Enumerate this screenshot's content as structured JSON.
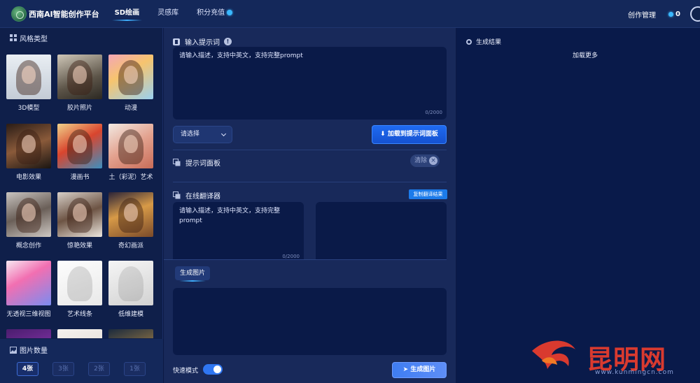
{
  "header": {
    "app_title": "西南AI智能创作平台",
    "nav": [
      {
        "label": "SD绘画",
        "active": true
      },
      {
        "label": "灵感库",
        "active": false
      },
      {
        "label": "积分充值",
        "active": false
      }
    ],
    "create_management": "创作管理",
    "points_value": "0"
  },
  "sidebar": {
    "style_title": "风格类型",
    "styles": [
      {
        "label": "3D模型"
      },
      {
        "label": "胶片照片"
      },
      {
        "label": "动漫"
      },
      {
        "label": "电影效果"
      },
      {
        "label": "漫画书"
      },
      {
        "label": "土（彩泥）艺术"
      },
      {
        "label": "概念创作"
      },
      {
        "label": "惊艳效果"
      },
      {
        "label": "奇幻画派"
      },
      {
        "label": "无透视三维视图"
      },
      {
        "label": "艺术线条"
      },
      {
        "label": "低维建模"
      },
      {
        "label": ""
      },
      {
        "label": ""
      },
      {
        "label": ""
      }
    ],
    "count_title": "图片数量",
    "counts": [
      {
        "label": "4张",
        "active": true
      },
      {
        "label": "3张",
        "active": false
      },
      {
        "label": "2张",
        "active": false
      },
      {
        "label": "1张",
        "active": false
      }
    ]
  },
  "prompt": {
    "title": "输入提示词",
    "placeholder": "请输入描述，支持中英文，支持完整prompt",
    "counter": "0/2000",
    "select_value": "请选择",
    "add_button": "加载到提示词面板",
    "panel_title": "提示词面板",
    "clear_button": "清除"
  },
  "translator": {
    "title": "在线翻译器",
    "copy_button": "复制翻译结果",
    "input_placeholder": "请输入描述，支持中英文，支持完整prompt",
    "counter": "0/2000"
  },
  "generate": {
    "tab_label": "生成图片",
    "fast_mode_label": "快速模式",
    "fast_mode_on": true,
    "button_label": "生成图片"
  },
  "results": {
    "title": "生成结果",
    "load_more": "加载更多"
  },
  "watermark": {
    "brand": "昆明网",
    "url": "www.kunmingcn.com"
  },
  "colors": {
    "primary": "#1f6bf0",
    "background": "#0c1a45",
    "panel": "#18295a",
    "accent": "#3ab8ff"
  }
}
